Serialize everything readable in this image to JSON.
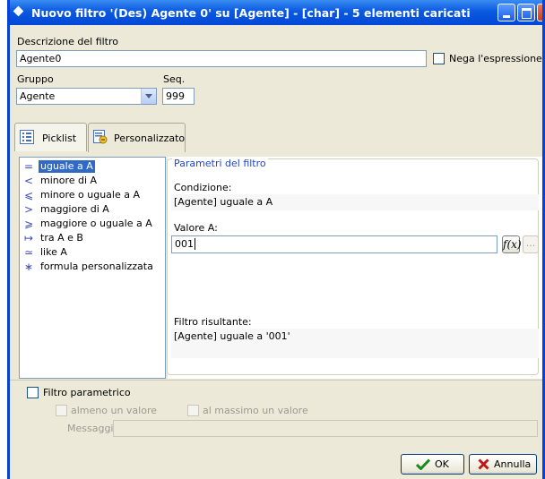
{
  "window": {
    "title": "Nuovo filtro '(Des) Agente 0' su [Agente] - [char] - 5 elementi caricati"
  },
  "header": {
    "description_label": "Descrizione del filtro",
    "description_value": "Agente0",
    "negate_label": "Nega l'espressione",
    "negate_checked": false,
    "group_label": "Gruppo",
    "group_value": "Agente",
    "seq_label": "Seq.",
    "seq_value": "999"
  },
  "tabs": [
    {
      "label": "Picklist",
      "icon": "list-icon",
      "active": false
    },
    {
      "label": "Personalizzato",
      "icon": "custom-filter-icon",
      "active": true
    }
  ],
  "operators": [
    {
      "symbol": "=",
      "label": "uguale a A",
      "selected": true
    },
    {
      "symbol": "<",
      "label": "minore di A",
      "selected": false
    },
    {
      "symbol": "⩽",
      "label": "minore o uguale a A",
      "selected": false
    },
    {
      "symbol": ">",
      "label": "maggiore di A",
      "selected": false
    },
    {
      "symbol": "⩾",
      "label": "maggiore o uguale a A",
      "selected": false
    },
    {
      "symbol": "↦",
      "label": "tra A e B",
      "selected": false
    },
    {
      "symbol": "≃",
      "label": "like A",
      "selected": false
    },
    {
      "symbol": "∗",
      "label": "formula personalizzata",
      "selected": false
    }
  ],
  "params": {
    "group_title": "Parametri del filtro",
    "condition_label": "Condizione:",
    "condition_value": "[Agente] uguale a A",
    "value_a_label": "Valore A:",
    "value_a": "001",
    "fx_label": "f(x)",
    "dots_label": "...",
    "result_label": "Filtro risultante:",
    "result_value": "[Agente] uguale a '001'"
  },
  "parametric": {
    "label": "Filtro parametrico",
    "checked": false,
    "at_least_one_label": "almeno un valore",
    "at_most_one_label": "al massimo un valore",
    "message_label": "Messaggio",
    "message_value": ""
  },
  "buttons": {
    "ok_label": "OK",
    "cancel_label": "Annulla"
  },
  "colors": {
    "title_bar": "#0a5ae0",
    "selection": "#316ac5",
    "group_title": "#2146c3",
    "ok_check": "#1a8a1a",
    "cancel_x": "#c0161a"
  }
}
